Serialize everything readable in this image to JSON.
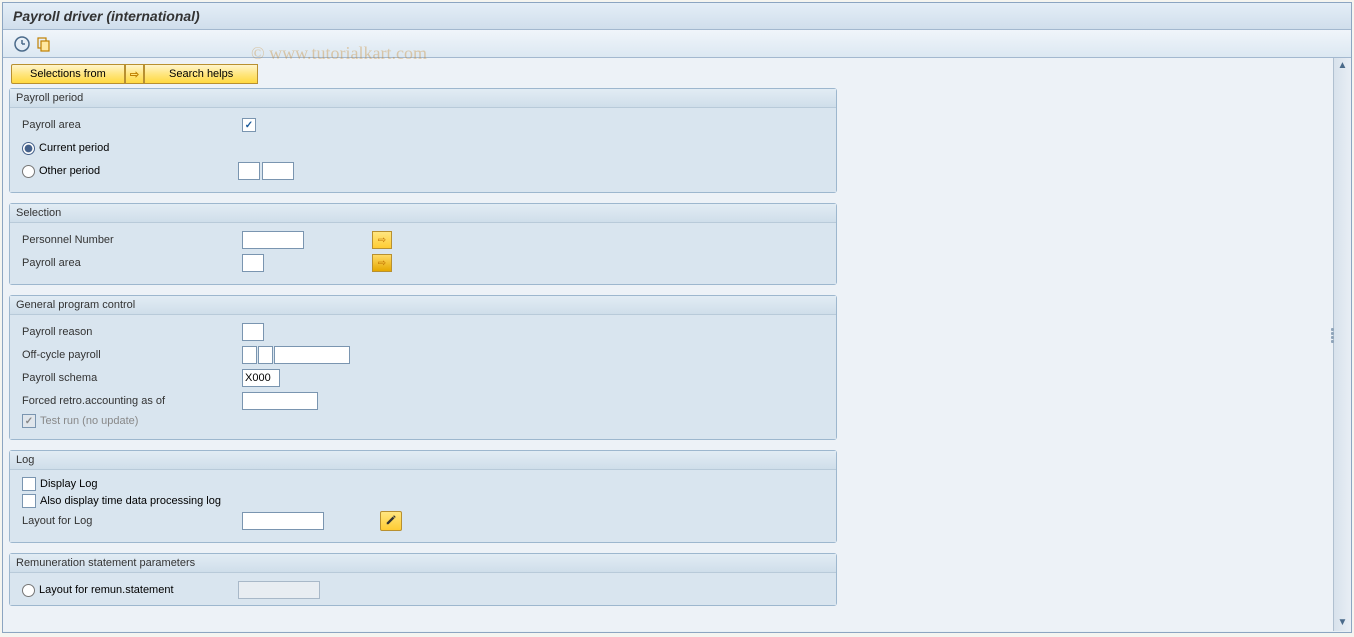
{
  "window": {
    "title": "Payroll driver (international)"
  },
  "watermark": "© www.tutorialkart.com",
  "buttons": {
    "selections_from": "Selections from",
    "search_helps": "Search helps"
  },
  "sections": {
    "payroll_period": {
      "title": "Payroll period",
      "payroll_area_label": "Payroll area",
      "payroll_area_checked": true,
      "current_period_label": "Current period",
      "current_period_selected": true,
      "other_period_label": "Other period",
      "other_period_selected": false,
      "other_period_val1": "",
      "other_period_val2": ""
    },
    "selection": {
      "title": "Selection",
      "personnel_number_label": "Personnel Number",
      "personnel_number_value": "",
      "payroll_area_label": "Payroll area",
      "payroll_area_value": ""
    },
    "general": {
      "title": "General program control",
      "payroll_reason_label": "Payroll reason",
      "payroll_reason_value": "",
      "off_cycle_label": "Off-cycle payroll",
      "off_cycle_val1": "",
      "off_cycle_val2": "",
      "off_cycle_val3": "",
      "schema_label": "Payroll schema",
      "schema_value": "X000",
      "forced_label": "Forced retro.accounting as of",
      "forced_value": "",
      "test_run_label": "Test run (no update)",
      "test_run_checked": true,
      "test_run_disabled": true
    },
    "log": {
      "title": "Log",
      "display_log_label": "Display Log",
      "display_log_checked": false,
      "also_time_label": "Also display time data processing log",
      "also_time_checked": false,
      "layout_label": "Layout for Log",
      "layout_value": ""
    },
    "remun": {
      "title": "Remuneration statement parameters",
      "layout_label": "Layout for remun.statement",
      "layout_selected": false,
      "layout_value": ""
    }
  }
}
